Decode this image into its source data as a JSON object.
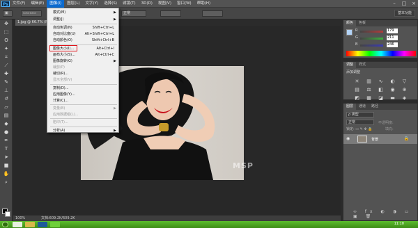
{
  "app": {
    "logo": "Ps"
  },
  "menubar": {
    "items": [
      "文件(F)",
      "编辑(E)",
      "图像(I)",
      "图层(L)",
      "文字(Y)",
      "选择(S)",
      "滤镜(T)",
      "3D(D)",
      "视图(V)",
      "窗口(W)",
      "帮助(H)"
    ],
    "active_index": 2
  },
  "optbar": {
    "mode_value": "正常",
    "workspace": "基本功能"
  },
  "document": {
    "tab_title": "1.jpg @ 66.7% (RGB/8)"
  },
  "image_menu": {
    "items": [
      {
        "label": "模式(M)",
        "shortcut": "",
        "submenu": true,
        "disabled": false
      },
      {
        "label": "调整(J)",
        "shortcut": "",
        "submenu": true,
        "disabled": false
      },
      {
        "label": "自动色调(N)",
        "shortcut": "Shift+Ctrl+L",
        "submenu": false,
        "disabled": false
      },
      {
        "label": "自动对比度(U)",
        "shortcut": "Alt+Shift+Ctrl+L",
        "submenu": false,
        "disabled": false
      },
      {
        "label": "自动颜色(O)",
        "shortcut": "Shift+Ctrl+B",
        "submenu": false,
        "disabled": false
      },
      {
        "label": "图像大小(I)...",
        "shortcut": "Alt+Ctrl+I",
        "submenu": false,
        "disabled": false
      },
      {
        "label": "画布大小(S)...",
        "shortcut": "Alt+Ctrl+C",
        "submenu": false,
        "disabled": false
      },
      {
        "label": "图像旋转(G)",
        "shortcut": "",
        "submenu": true,
        "disabled": false
      },
      {
        "label": "裁剪(P)",
        "shortcut": "",
        "submenu": false,
        "disabled": true
      },
      {
        "label": "裁切(R)...",
        "shortcut": "",
        "submenu": false,
        "disabled": false
      },
      {
        "label": "显示全部(V)",
        "shortcut": "",
        "submenu": false,
        "disabled": true
      },
      {
        "label": "复制(D)...",
        "shortcut": "",
        "submenu": false,
        "disabled": false
      },
      {
        "label": "应用图像(Y)...",
        "shortcut": "",
        "submenu": false,
        "disabled": false
      },
      {
        "label": "计算(C)...",
        "shortcut": "",
        "submenu": false,
        "disabled": false
      },
      {
        "label": "变量(B)",
        "shortcut": "",
        "submenu": true,
        "disabled": true
      },
      {
        "label": "应用数据组(L)...",
        "shortcut": "",
        "submenu": false,
        "disabled": true
      },
      {
        "label": "陷印(T)...",
        "shortcut": "",
        "submenu": false,
        "disabled": true
      },
      {
        "label": "分析(A)",
        "shortcut": "",
        "submenu": true,
        "disabled": false
      }
    ]
  },
  "canvas": {
    "watermark": "MSP"
  },
  "statusbar": {
    "zoom": "100%",
    "doc": "文档:609.2K/609.2K"
  },
  "color_panel": {
    "tabs": [
      "颜色",
      "色板"
    ],
    "sliders": [
      {
        "label": "R",
        "value": "179",
        "color": "#b33a3a"
      },
      {
        "label": "G",
        "value": "211",
        "color": "#3ab33a"
      },
      {
        "label": "B",
        "value": "246",
        "color": "#3a3ab3"
      }
    ]
  },
  "adjust_panel": {
    "tabs": [
      "调整",
      "样式"
    ],
    "title": "添加调整"
  },
  "layers_panel": {
    "tabs": [
      "图层",
      "通道",
      "路径"
    ],
    "mode": "正常",
    "opacity_label": "不透明度:",
    "fill_label": "填充:",
    "layer_name": "背景"
  },
  "taskbar": {
    "clock": "11:10"
  },
  "colors": {
    "accent": "#0c6bd0",
    "highlight": "#e0141b",
    "taskbar": "#4aa51f"
  }
}
